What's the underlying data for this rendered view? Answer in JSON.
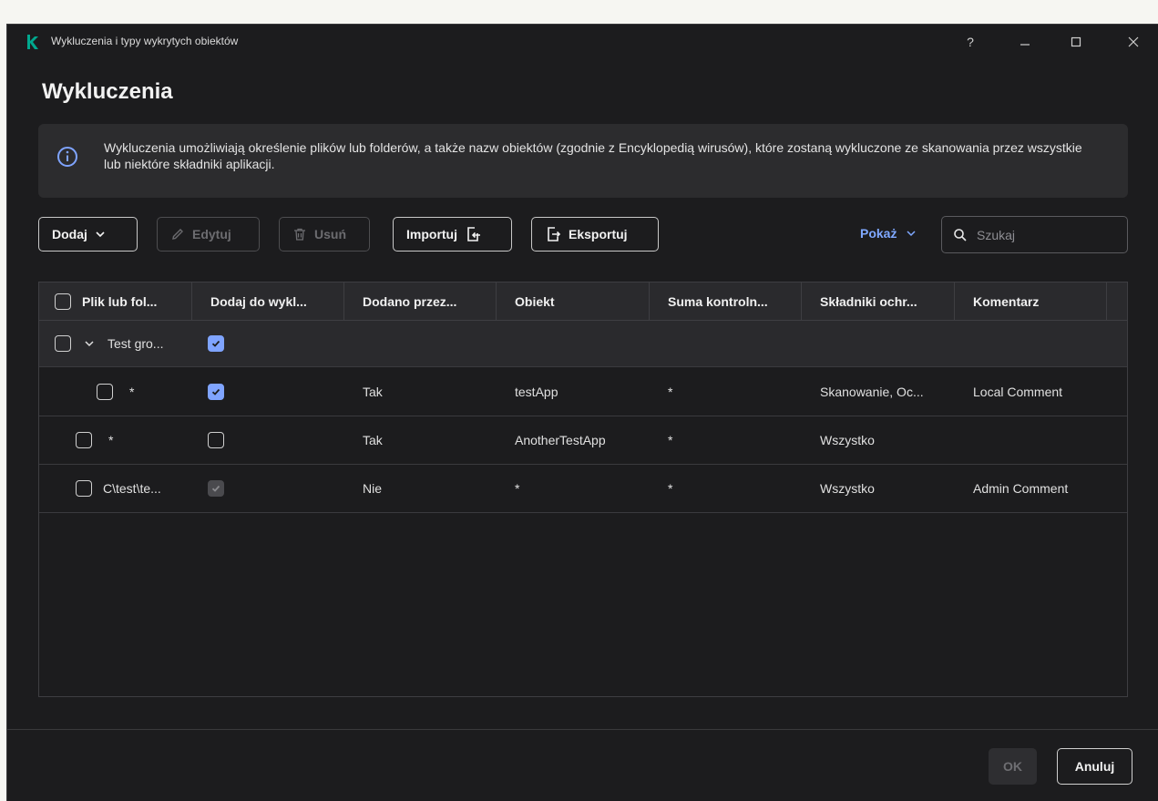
{
  "window": {
    "title": "Wykluczenia i typy wykrytych obiektów",
    "help": "?"
  },
  "page": {
    "title": "Wykluczenia"
  },
  "info": {
    "text": "Wykluczenia umożliwiają określenie plików lub folderów, a także nazw obiektów (zgodnie z Encyklopedią wirusów), które zostaną wykluczone ze skanowania przez wszystkie lub niektóre składniki aplikacji."
  },
  "toolbar": {
    "add": "Dodaj",
    "edit": "Edytuj",
    "delete": "Usuń",
    "import": "Importuj",
    "export": "Eksportuj",
    "show": "Pokaż",
    "search_placeholder": "Szukaj"
  },
  "table": {
    "columns": [
      "Plik lub fol...",
      "Dodaj do wykl...",
      "Dodano przez...",
      "Obiekt",
      "Suma kontroln...",
      "Składniki ochr...",
      "Komentarz"
    ],
    "group": {
      "name": "Test gro..."
    },
    "rows": [
      {
        "file": "*",
        "added_by": "Tak",
        "object": "testApp",
        "checksum": "*",
        "components": "Skanowanie, Oc...",
        "comment": "Local Comment"
      },
      {
        "file": "*",
        "added_by": "Tak",
        "object": "AnotherTestApp",
        "checksum": "*",
        "components": "Wszystko",
        "comment": ""
      },
      {
        "file": "C\\test\\te...",
        "added_by": "Nie",
        "object": "*",
        "checksum": "*",
        "components": "Wszystko",
        "comment": "Admin Comment"
      }
    ]
  },
  "footer": {
    "ok": "OK",
    "cancel": "Anuluj"
  },
  "colors": {
    "accent": "#7fa4ff",
    "logo": "#00a88e",
    "background": "#1c1c1e"
  }
}
